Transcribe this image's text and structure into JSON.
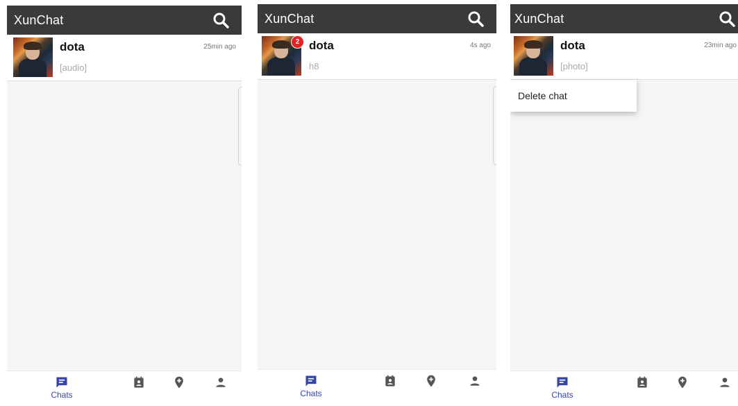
{
  "app": {
    "title": "XunChat"
  },
  "screens": [
    {
      "chat": {
        "name": "dota",
        "time": "25min ago",
        "preview": "[audio]",
        "badge": ""
      }
    },
    {
      "chat": {
        "name": "dota",
        "time": "4s ago",
        "preview": "h8",
        "badge": "2"
      }
    },
    {
      "chat": {
        "name": "dota",
        "time": "23min ago",
        "preview": "[photo]",
        "badge": ""
      },
      "context_menu": {
        "items": [
          "Delete chat"
        ]
      }
    }
  ],
  "nav": {
    "items": [
      {
        "label": "Chats",
        "icon": "chat-icon",
        "active": true
      },
      {
        "label": "",
        "icon": "contacts-icon",
        "active": false
      },
      {
        "label": "",
        "icon": "location-pin-icon",
        "active": false
      },
      {
        "label": "",
        "icon": "person-icon",
        "active": false
      }
    ]
  },
  "colors": {
    "topbar": "#3a3a3c",
    "accent": "#3546a9",
    "badge": "#e52222",
    "inactive_icon": "#555555"
  }
}
